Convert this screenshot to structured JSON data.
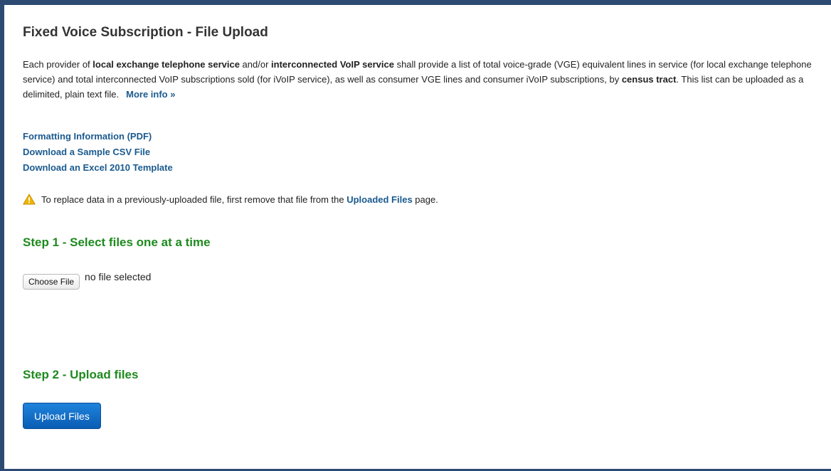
{
  "page": {
    "title": "Fixed Voice Subscription - File Upload"
  },
  "intro": {
    "t1": "Each provider of ",
    "b1": "local exchange telephone service",
    "t2": " and/or ",
    "b2": "interconnected VoIP service",
    "t3": " shall provide a list of total voice-grade (VGE) equivalent lines in service (for local exchange telephone service) and total interconnected VoIP subscriptions sold (for iVoIP service), as well as consumer VGE lines and consumer iVoIP subscriptions, by ",
    "b3": "census tract",
    "t4": ". This list can be uploaded as a delimited, plain text file.",
    "more_info": "More info »"
  },
  "resources": {
    "formatting": "Formatting Information (PDF)",
    "sample_csv": "Download a Sample CSV File",
    "excel_template": "Download an Excel 2010 Template"
  },
  "warning": {
    "icon": "warning-icon",
    "text_before": "To replace data in a previously-uploaded file, first remove that file from the ",
    "link": "Uploaded Files",
    "text_after": " page."
  },
  "step1": {
    "title": "Step 1 - Select files one at a time",
    "choose_label": "Choose File",
    "status": "no file selected"
  },
  "step2": {
    "title": "Step 2 - Upload files",
    "button_label": "Upload Files"
  },
  "colors": {
    "frame_border": "#2d4a73",
    "link": "#1a5a8f",
    "step_heading": "#1e8a1e",
    "primary_button": "#0a6ccc",
    "warning_icon": "#f0b400"
  }
}
